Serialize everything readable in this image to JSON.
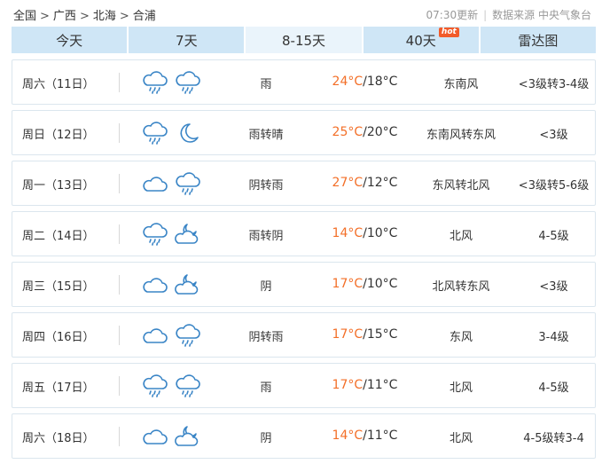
{
  "breadcrumb": {
    "items": [
      "全国",
      "广西",
      "北海",
      "合浦"
    ],
    "separator": ">"
  },
  "meta": {
    "update_time": "07:30更新",
    "source": "数据来源 中央气象台"
  },
  "tabs": [
    {
      "label": "今天",
      "active": false,
      "badge": ""
    },
    {
      "label": "7天",
      "active": false,
      "badge": ""
    },
    {
      "label": "8-15天",
      "active": true,
      "badge": ""
    },
    {
      "label": "40天",
      "active": false,
      "badge": "hot"
    },
    {
      "label": "雷达图",
      "active": false,
      "badge": ""
    }
  ],
  "forecast": [
    {
      "date": "周六（11日）",
      "icons": [
        "rain-cloud-icon",
        "rain-cloud-icon"
      ],
      "condition": "雨",
      "high": "24°C",
      "low": "/18°C",
      "wind_dir": "东南风",
      "wind_level": "<3级转3-4级"
    },
    {
      "date": "周日（12日）",
      "icons": [
        "rain-cloud-icon",
        "moon-icon"
      ],
      "condition": "雨转晴",
      "high": "25°C",
      "low": "/20°C",
      "wind_dir": "东南风转东风",
      "wind_level": "<3级"
    },
    {
      "date": "周一（13日）",
      "icons": [
        "cloud-icon",
        "rain-cloud-icon"
      ],
      "condition": "阴转雨",
      "high": "27°C",
      "low": "/12°C",
      "wind_dir": "东风转北风",
      "wind_level": "<3级转5-6级"
    },
    {
      "date": "周二（14日）",
      "icons": [
        "rain-cloud-icon",
        "moon-cloud-icon"
      ],
      "condition": "雨转阴",
      "high": "14°C",
      "low": "/10°C",
      "wind_dir": "北风",
      "wind_level": "4-5级"
    },
    {
      "date": "周三（15日）",
      "icons": [
        "cloud-icon",
        "moon-cloud-icon"
      ],
      "condition": "阴",
      "high": "17°C",
      "low": "/10°C",
      "wind_dir": "北风转东风",
      "wind_level": "<3级"
    },
    {
      "date": "周四（16日）",
      "icons": [
        "cloud-icon",
        "rain-cloud-icon"
      ],
      "condition": "阴转雨",
      "high": "17°C",
      "low": "/15°C",
      "wind_dir": "东风",
      "wind_level": "3-4级"
    },
    {
      "date": "周五（17日）",
      "icons": [
        "rain-cloud-icon",
        "rain-cloud-icon"
      ],
      "condition": "雨",
      "high": "17°C",
      "low": "/11°C",
      "wind_dir": "北风",
      "wind_level": "4-5级"
    },
    {
      "date": "周六（18日）",
      "icons": [
        "cloud-icon",
        "moon-cloud-icon"
      ],
      "condition": "阴",
      "high": "14°C",
      "low": "/11°C",
      "wind_dir": "北风",
      "wind_level": "4-5级转3-4"
    }
  ],
  "colors": {
    "tab_bg": "#cfe6f6",
    "tab_active_bg": "#eaf4fb",
    "high_temp": "#f36f28",
    "icon": "#3a85c6",
    "hot_badge": "#f25b2a"
  }
}
